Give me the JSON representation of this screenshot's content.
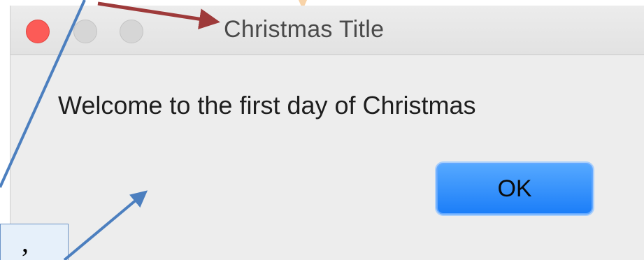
{
  "window": {
    "title": "Christmas Title",
    "message": "Welcome to the first day of Christmas",
    "ok_label": "OK"
  },
  "annotation": {
    "callout_text": ","
  },
  "colors": {
    "close_button": "#fc5b57",
    "ok_button": "#1c7ef8",
    "arrow_red": "#9e3a3a",
    "arrow_blue": "#4c7fbf",
    "callout_fill": "#e6f0fa"
  },
  "icons": {
    "close": "close-icon",
    "minimize": "minimize-icon",
    "zoom": "zoom-icon"
  }
}
